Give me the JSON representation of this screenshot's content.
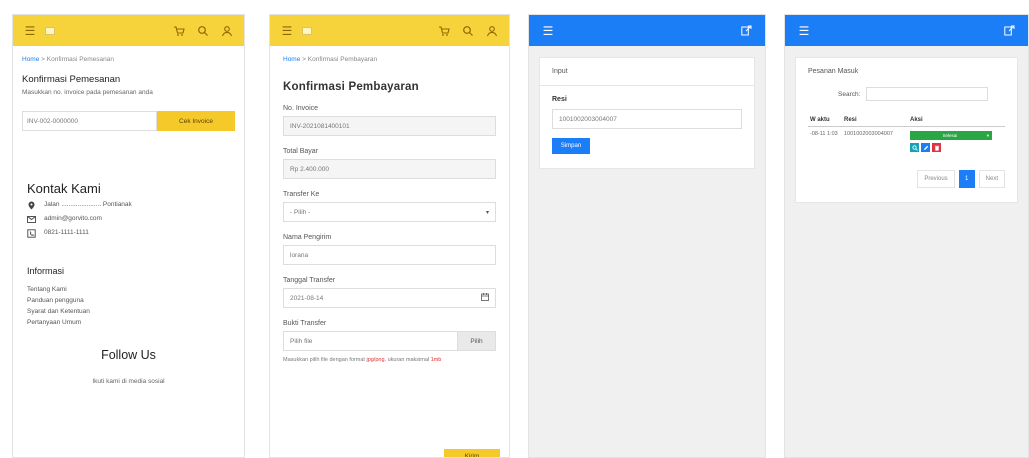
{
  "panel1": {
    "breadcrumb_home": "Home",
    "breadcrumb_sep": ">",
    "breadcrumb_current": "Konfirmasi Pemesanan",
    "title": "Konfirmasi Pemesanan",
    "description": "Masukkan no. invoice pada pemesanan anda",
    "input_value": "INV-002-0000000",
    "button": "Cek Invoice",
    "kontak_title": "Kontak Kami",
    "kontak": [
      {
        "icon": "location-pin-icon",
        "text": "Jalan ...................... Pontianak"
      },
      {
        "icon": "mail-icon",
        "text": "admin@gorvito.com"
      },
      {
        "icon": "phone-icon",
        "text": "0821-1111-1111"
      }
    ],
    "info_title": "Informasi",
    "info_items": [
      "Tentang Kami",
      "Panduan pengguna",
      "Syarat dan Ketentuan",
      "Pertanyaan Umum"
    ],
    "follow_title": "Follow Us",
    "follow_sub": "Ikuti kami di media sosial"
  },
  "panel2": {
    "breadcrumb_home": "Home",
    "breadcrumb_sep": ">",
    "breadcrumb_current": "Konfirmasi Pembayaran",
    "title": "Konfirmasi Pembayaran",
    "fields": [
      {
        "label": "No. Invoice",
        "value": "INV-2021081400101",
        "grey": true
      },
      {
        "label": "Total Bayar",
        "value": "Rp 2.400.000",
        "grey": true
      },
      {
        "label": "Transfer Ke",
        "value": "- Pilih -",
        "grey": false,
        "select": true
      },
      {
        "label": "Nama Pengirim",
        "value": "lorana",
        "grey": false
      },
      {
        "label": "Tanggal Transfer",
        "value": "2021-08-14",
        "grey": false,
        "date": true
      }
    ],
    "bukti_label": "Bukti Transfer",
    "bukti_placeholder": "Pilih file",
    "bukti_button": "Pilih",
    "hint_before": "Masukkan pilih file dengan format ",
    "hint_red": "jpg/png",
    "hint_after": ", ukuran maksimal ",
    "hint_red2": "1mb",
    "submit": "Kirim"
  },
  "panel3": {
    "card_title": "Input",
    "resi_label": "Resi",
    "resi_value": "1001002003004007",
    "button": "Simpan"
  },
  "panel4": {
    "card_title": "Pesanan Masuk",
    "search_label": "Search:",
    "columns": [
      "W aktu",
      "Resi",
      "Aksi"
    ],
    "row": {
      "waktu": "-08-11 1:03",
      "resi": "1001002003004007",
      "status": "Selesai"
    },
    "pager": {
      "prev": "Previous",
      "page": "1",
      "next": "Next"
    }
  },
  "colors": {
    "yellow": "#f6d23b",
    "blue": "#1b7ef6",
    "green": "#2aa744",
    "red": "#dc3545",
    "teal": "#17a2b8"
  }
}
